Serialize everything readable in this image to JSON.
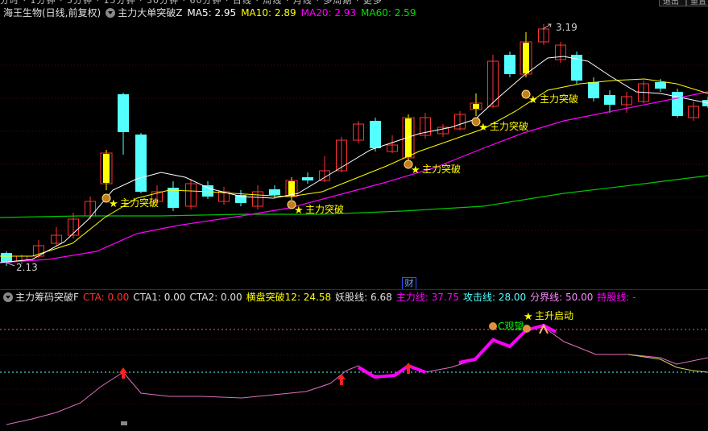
{
  "menu": {
    "text": "分时 · 1分钟 · 5分钟 · 15分钟 · 30分钟 · 60分钟 · 日线 · 周线 · 月线 · 多周期 · 更多",
    "right_btn_1": "退出",
    "right_btn_2": "重置"
  },
  "main_legend": {
    "title": "海王生物(日线,前复权)",
    "indicator": "主力大单突破Z",
    "ma5": "MA5: 2.95",
    "ma10": "MA10: 2.89",
    "ma20": "MA20: 2.93",
    "ma60": "MA60: 2.59"
  },
  "main_chart": {
    "high_label": "3.19",
    "low_label": "2.13",
    "signal_text": "主力突破",
    "cai_marker": "财",
    "colors": {
      "up": "#ff3232",
      "down": "#54ffff",
      "signal": "#ffff00",
      "ma5": "#ffffff",
      "ma10": "#ffff00",
      "ma20": "#ff00ff",
      "ma60": "#00c800"
    }
  },
  "sub_legend": {
    "title": "主力筹码突破F",
    "cta": "CTA: 0.00",
    "cta1": "CTA1: 0.00",
    "cta2": "CTA2: 0.00",
    "hp": "横盘突破12: 24.58",
    "yao": "妖股线: 6.68",
    "zl": "主力线: 37.75",
    "gj": "攻击线: 28.00",
    "fj": "分界线: 50.00",
    "cg": "持股线: -"
  },
  "sub_chart": {
    "watch_label": "C观望",
    "launch_label": "主升启动"
  }
}
